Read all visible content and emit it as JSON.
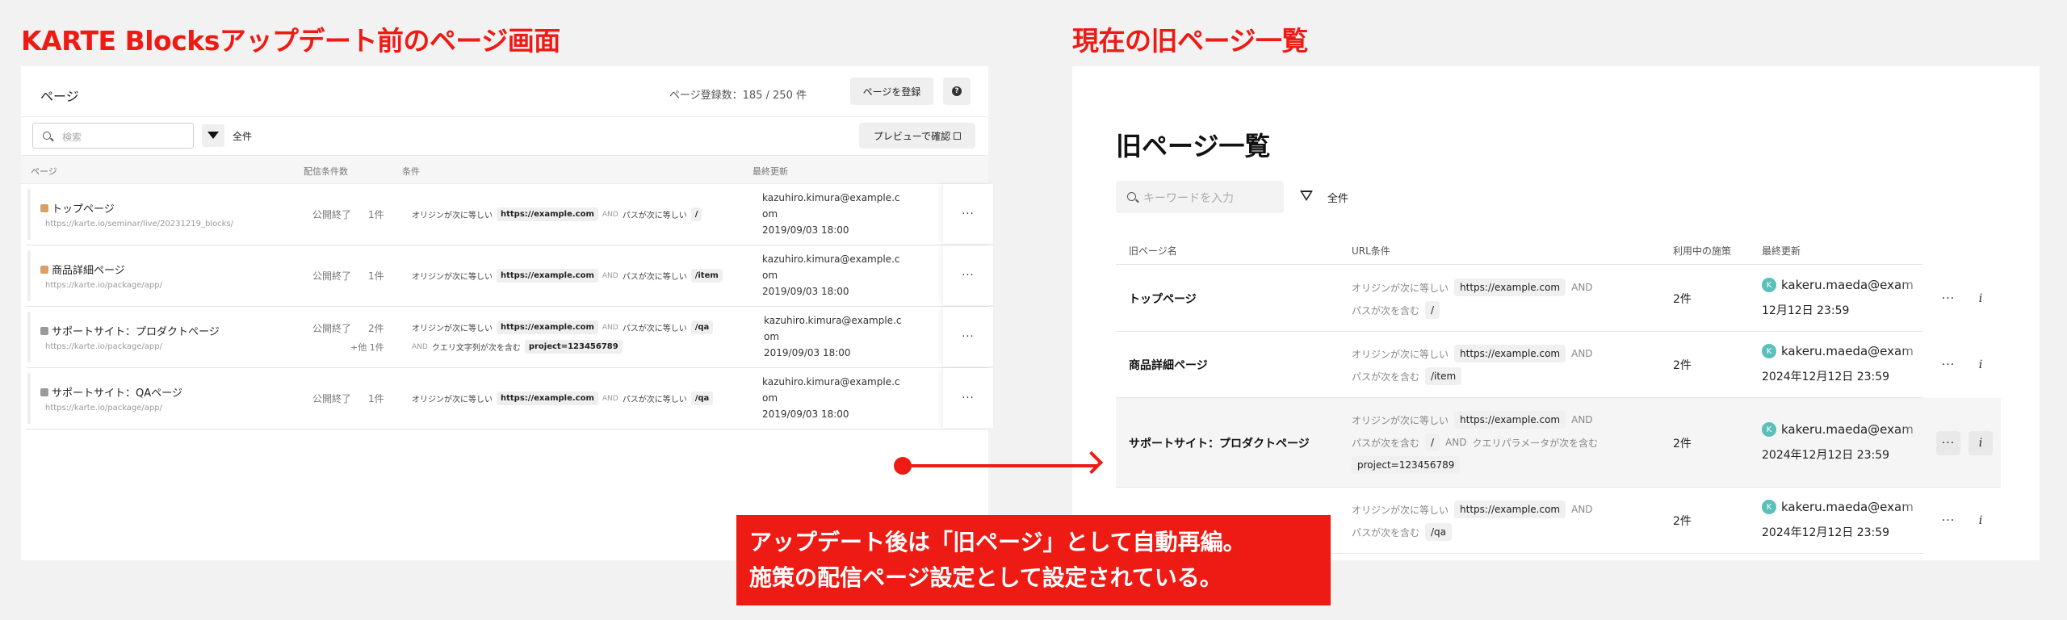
{
  "left_heading": "KARTE Blocksアップデート前のページ画面",
  "right_heading": "現在の旧ページ一覧",
  "left": {
    "title": "ページ",
    "count_text": "ページ登録数：185 / 250 件",
    "register_button": "ページを登録",
    "help_icon": "question-icon",
    "search_placeholder": "検索",
    "filter_label": "全件",
    "preview_button": "プレビューで確認",
    "columns": [
      "ページ",
      "配信条件数",
      "条件",
      "最終更新"
    ],
    "rows": [
      {
        "icon_color": "#d9a066",
        "name": "トップページ",
        "url": "https://karte.io/seminar/live/20231219_blocks/",
        "status": "公開終了",
        "count": "1件",
        "cond1": {
          "a": "オリジンが次に等しい",
          "v1": "https://example.com",
          "and": "AND",
          "b": "パスが次に等しい",
          "v2": "/"
        },
        "updated_email_1": "kazuhiro.kimura@example.c",
        "updated_email_2": "om",
        "updated_date": "2019/09/03 18:00"
      },
      {
        "icon_color": "#d9a066",
        "name": "商品詳細ページ",
        "url": "https://karte.io/package/app/",
        "status": "公開終了",
        "count": "1件",
        "cond1": {
          "a": "オリジンが次に等しい",
          "v1": "https://example.com",
          "and": "AND",
          "b": "パスが次に等しい",
          "v2": "/item"
        },
        "updated_email_1": "kazuhiro.kimura@example.c",
        "updated_email_2": "om",
        "updated_date": "2019/09/03 18:00"
      },
      {
        "icon_color": "#9a9a9a",
        "name": "サポートサイト：プロダクトページ",
        "url": "https://karte.io/package/app/",
        "status": "公開終了",
        "count": "2件",
        "more": "+他 1件",
        "cond1": {
          "a": "オリジンが次に等しい",
          "v1": "https://example.com",
          "and": "AND",
          "b": "パスが次に等しい",
          "v2": "/qa"
        },
        "cond2": {
          "and": "AND",
          "a": "クエリ文字列が次を含む",
          "v1": "project=123456789"
        },
        "updated_email_1": "kazuhiro.kimura@example.c",
        "updated_email_2": "om",
        "updated_date": "2019/09/03 18:00"
      },
      {
        "icon_color": "#9a9a9a",
        "name": "サポートサイト：QAページ",
        "url": "https://karte.io/package/app/",
        "status": "公開終了",
        "count": "1件",
        "cond1": {
          "a": "オリジンが次に等しい",
          "v1": "https://example.com",
          "and": "AND",
          "b": "パスが次に等しい",
          "v2": "/qa"
        },
        "updated_email_1": "kazuhiro.kimura@example.c",
        "updated_email_2": "om",
        "updated_date": "2019/09/03 18:00"
      }
    ],
    "row_action": "···"
  },
  "right": {
    "title": "旧ページ一覧",
    "search_placeholder": "キーワードを入力",
    "filter_label": "全件",
    "columns": [
      "旧ページ名",
      "URL条件",
      "利用中の施策",
      "最終更新"
    ],
    "rows": [
      {
        "name": "トップページ",
        "l1a": "オリジンが次に等しい",
        "l1v": "https://example.com",
        "l1and": "AND",
        "l2a": "パスが次を含む",
        "l2v": "/",
        "count": "2件",
        "avatar": "K",
        "user": "kakeru.maeda@exam",
        "date": "12月12日 23:59"
      },
      {
        "name": "商品詳細ページ",
        "l1a": "オリジンが次に等しい",
        "l1v": "https://example.com",
        "l1and": "AND",
        "l2a": "パスが次を含む",
        "l2v": "/item",
        "count": "2件",
        "avatar": "K",
        "user": "kakeru.maeda@exam",
        "date": "2024年12月12日 23:59"
      },
      {
        "name": "サポートサイト：プロダクトページ",
        "l1a": "オリジンが次に等しい",
        "l1v": "https://example.com",
        "l1and": "AND",
        "l2a": "パスが次を含む",
        "l2v": "/",
        "l2and": "AND",
        "l2b": "クエリパラメータが次を含む",
        "l3v": "project=123456789",
        "count": "2件",
        "avatar": "K",
        "user": "kakeru.maeda@exam",
        "date": "2024年12月12日 23:59"
      },
      {
        "name": "",
        "l1a": "オリジンが次に等しい",
        "l1v": "https://example.com",
        "l1and": "AND",
        "l2a": "パスが次を含む",
        "l2v": "/qa",
        "count": "2件",
        "avatar": "K",
        "user": "kakeru.maeda@exam",
        "date": "2024年12月12日 23:59"
      }
    ],
    "ellipsis": "···",
    "info": "i"
  },
  "callout": {
    "line1": "アップデート後は「旧ページ」として自動再編。",
    "line2": "施策の配信ページ設定として設定されている。"
  },
  "colors": {
    "accent": "#ee1b14",
    "avatar": "#5bbfba"
  }
}
